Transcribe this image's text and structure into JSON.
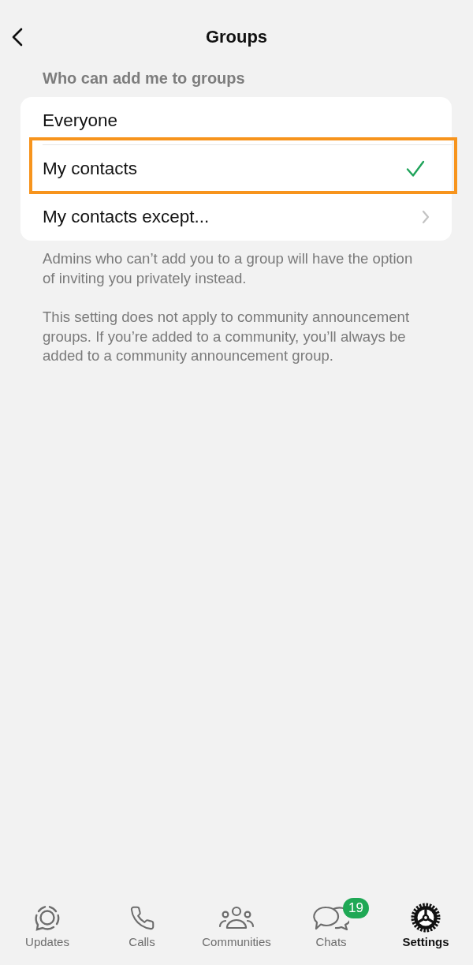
{
  "header": {
    "title": "Groups"
  },
  "section": {
    "title": "Who can add me to groups",
    "options": [
      {
        "label": "Everyone",
        "kind": "choice",
        "selected": false,
        "highlighted": false
      },
      {
        "label": "My contacts",
        "kind": "choice",
        "selected": true,
        "highlighted": true
      },
      {
        "label": "My contacts except...",
        "kind": "submenu",
        "selected": false,
        "highlighted": false
      }
    ]
  },
  "notes": [
    "Admins who can’t add you to a group will have the option of inviting you privately instead.",
    "This setting does not apply to community announcement groups. If you’re added to a community, you’ll always be added to a community announcement group."
  ],
  "tab_bar": [
    {
      "label": "Updates",
      "selected": false
    },
    {
      "label": "Calls",
      "selected": false
    },
    {
      "label": "Communities",
      "selected": false
    },
    {
      "label": "Chats",
      "selected": false,
      "badge": "19"
    },
    {
      "label": "Settings",
      "selected": true
    }
  ]
}
